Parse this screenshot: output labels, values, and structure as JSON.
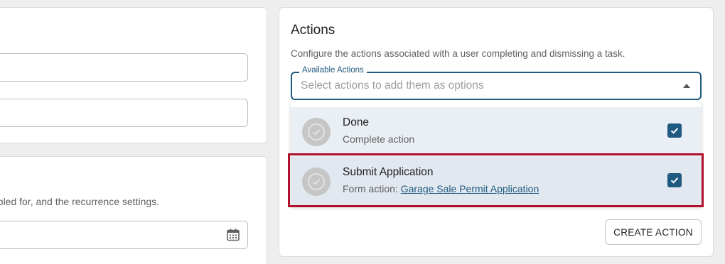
{
  "left_panel": {
    "recurrence_description": "abled for, and the recurrence settings."
  },
  "actions_panel": {
    "title": "Actions",
    "description": "Configure the actions associated with a user completing and dismissing a task.",
    "available_actions": {
      "legend": "Available Actions",
      "placeholder": "Select actions to add them as options"
    },
    "options": [
      {
        "title": "Done",
        "subtitle": "Complete action",
        "checked": true
      },
      {
        "title": "Submit Application",
        "subtitle_prefix": "Form action: ",
        "link": "Garage Sale Permit Application",
        "checked": true
      }
    ],
    "create_button": "CREATE ACTION"
  },
  "colors": {
    "accent": "#1f5a80",
    "highlight": "#b0102e",
    "avatar": "#c6c6c6"
  },
  "icons": [
    "calendar-icon",
    "dropdown-arrow-icon",
    "check-circle-icon",
    "checkbox-checked-icon"
  ]
}
